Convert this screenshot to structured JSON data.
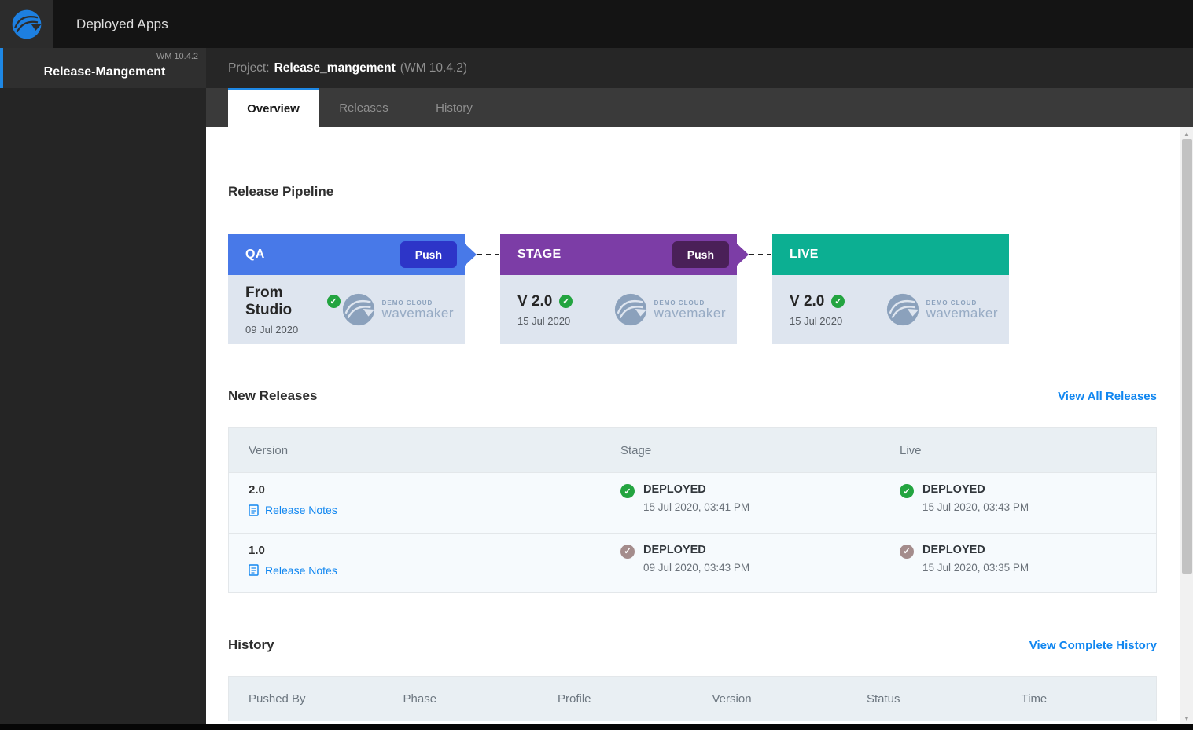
{
  "topbar": {
    "title": "Deployed Apps"
  },
  "sidebar": {
    "items": [
      {
        "label": "Release-Mangement",
        "version_badge": "WM 10.4.2"
      }
    ]
  },
  "project_header": {
    "label": "Project:",
    "name": "Release_mangement",
    "version": "(WM 10.4.2)"
  },
  "tabs": [
    {
      "label": "Overview",
      "active": true
    },
    {
      "label": "Releases",
      "active": false
    },
    {
      "label": "History",
      "active": false
    }
  ],
  "pipeline": {
    "heading": "Release Pipeline",
    "brand": {
      "line1": "DEMO CLOUD",
      "line2": "wavemaker"
    },
    "stages": [
      {
        "name": "QA",
        "action": "Push",
        "version": "From Studio",
        "date": "09 Jul 2020",
        "header_color": "#4879e8",
        "action_color": "#2d35c8"
      },
      {
        "name": "STAGE",
        "action": "Push",
        "version": "V 2.0",
        "date": "15 Jul 2020",
        "header_color": "#7c3da6",
        "action_color": "#4a2058"
      },
      {
        "name": "LIVE",
        "version": "V 2.0",
        "date": "15 Jul 2020",
        "header_color": "#0caf92"
      }
    ]
  },
  "new_releases": {
    "heading": "New Releases",
    "view_all_label": "View All Releases",
    "columns": [
      "Version",
      "Stage",
      "Live"
    ],
    "release_notes_label": "Release Notes",
    "rows": [
      {
        "version": "2.0",
        "stage": {
          "status": "DEPLOYED",
          "time": "15 Jul 2020, 03:41 PM",
          "check_color": "#23a440"
        },
        "live": {
          "status": "DEPLOYED",
          "time": "15 Jul 2020, 03:43 PM",
          "check_color": "#23a440"
        }
      },
      {
        "version": "1.0",
        "stage": {
          "status": "DEPLOYED",
          "time": "09 Jul 2020, 03:43 PM",
          "check_color": "#a48c8c"
        },
        "live": {
          "status": "DEPLOYED",
          "time": "15 Jul 2020, 03:35 PM",
          "check_color": "#a48c8c"
        }
      }
    ]
  },
  "history": {
    "heading": "History",
    "view_all_label": "View Complete History",
    "columns": [
      "Pushed By",
      "Phase",
      "Profile",
      "Version",
      "Status",
      "Time"
    ]
  },
  "colors": {
    "accent_blue": "#1e88e5",
    "link_blue": "#1086f0",
    "check_green": "#23a440",
    "check_muted": "#a48c8c",
    "qa_header": "#4879e8",
    "stage_header": "#7c3da6",
    "live_header": "#0caf92",
    "brand_logo_blue": "#1d7fe0"
  }
}
